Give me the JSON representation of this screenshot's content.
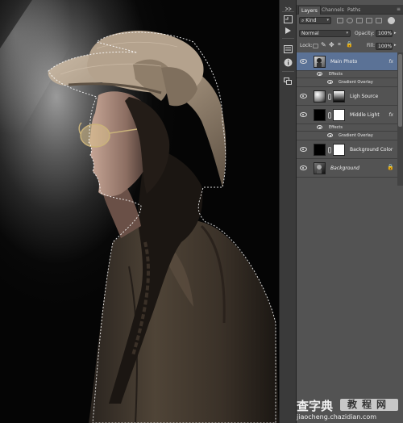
{
  "panel": {
    "tabs": [
      "Layers",
      "Channels",
      "Paths"
    ],
    "menu_icon": "panel-menu-icon",
    "filter_kind": "Kind",
    "blend_mode": "Normal",
    "opacity_label": "Opacity:",
    "opacity_value": "100%",
    "lock_label": "Lock:",
    "fill_label": "Fill:",
    "fill_value": "100%"
  },
  "layers": [
    {
      "name": "Main Photo",
      "selected": true,
      "fx": "fx",
      "effects_label": "Effects",
      "effect": "Gradient Overlay"
    },
    {
      "name": "Ligh Source",
      "selected": false
    },
    {
      "name": "Middle Light",
      "selected": false,
      "fx": "fx",
      "effects_label": "Effects",
      "effect": "Gradient Overlay"
    },
    {
      "name": "Background Color",
      "selected": false
    },
    {
      "name": "Background",
      "selected": false,
      "italic": true,
      "locked": true
    }
  ],
  "dock_icons": [
    "collapse-icon",
    "history-icon",
    "play-icon",
    "properties-icon",
    "info-icon",
    "layer-comps-icon"
  ],
  "watermark": {
    "title": "查字典",
    "box": "教程网",
    "url": "jiaocheng.chazidian.com"
  },
  "colors": {
    "panel_bg": "#535353",
    "selected_row": "#5b7296",
    "canvas_bg": "#050505"
  }
}
